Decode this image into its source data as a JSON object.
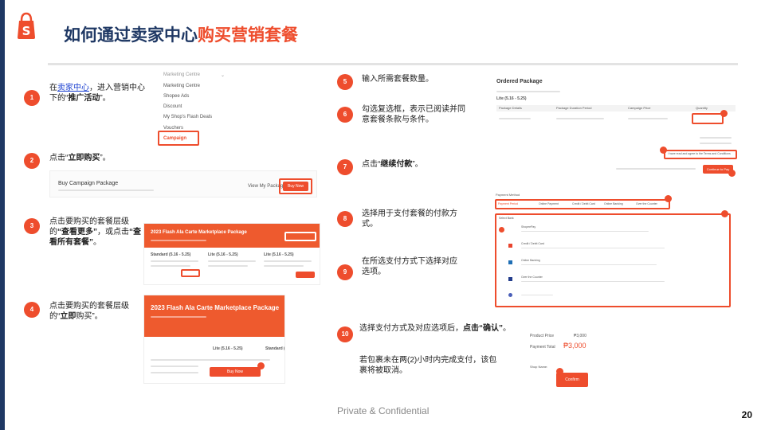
{
  "header": {
    "title_main": "如何通过卖家中心",
    "title_accent": "购买营销套餐"
  },
  "steps": [
    {
      "num": "1",
      "pre": "在",
      "link": "卖家中心",
      "mid": "，进入营销中心下的“",
      "bold": "推广活动",
      "post": "”。"
    },
    {
      "num": "2",
      "pre": "点击“",
      "bold": "立即购买",
      "post": "”。"
    },
    {
      "num": "3",
      "pre": "点击要购买的套餐层级的",
      "bold": "“查看更多”",
      "mid": "，或点击",
      "bold2": "“查看所有套餐”",
      "post": "。"
    },
    {
      "num": "4",
      "pre": "点击要购买的套餐层级的“",
      "bold": "立即",
      "post": "购买”。"
    },
    {
      "num": "5",
      "text": "输入所需套餐数量。"
    },
    {
      "num": "6",
      "text": "勾选复选框，表示已阅读并同意套餐条款与条件。"
    },
    {
      "num": "7",
      "pre": "点击“",
      "bold": "继续付款",
      "post": "”。"
    },
    {
      "num": "8",
      "text": "选择用于支付套餐的付款方式。"
    },
    {
      "num": "9",
      "text": "在所选支付方式下选择对应选项。"
    },
    {
      "num": "10",
      "pre": "选择支付方式及对应选项后，",
      "bold": "点击“确认”",
      "post": "。",
      "note": "若包裹未在两(2)小时内完成支付，该包裹将被取消。"
    }
  ],
  "menu_shot": {
    "header": "Marketing Centre",
    "items": [
      "Marketing Centre",
      "Shopee Ads",
      "Discount",
      "My Shop's Flash Deals",
      "Vouchers",
      "Campaign"
    ]
  },
  "buy_shot": {
    "title": "Buy Campaign Package",
    "view_label": "View My Package",
    "buy_label": "Buy Now"
  },
  "package_shot": {
    "title": "2023 Flash Ala Carte Marketplace Package",
    "tiers": [
      "Standard (5.16 - 5.25)",
      "Lite (5.16 - 5.25)",
      "Lite (5.16 - 5.25)"
    ]
  },
  "package_shot2": {
    "title": "2023 Flash Ala Carte Marketplace Package",
    "tier_left": "Lite (5.16 - 5.25)",
    "tier_right": "Standard (",
    "buy_label": "Buy Now"
  },
  "order_shot": {
    "title": "Ordered Package",
    "tier": "Lite (5.16 - 5.25)",
    "cols": [
      "Package Details",
      "Package Duration Period",
      "Campaign Price",
      "Quantity"
    ],
    "checkbox_label": "I have read and agree to the Terms and Conditions",
    "continue_label": "Continue to Pay"
  },
  "payment_shot": {
    "title": "Payment Method",
    "tabs": [
      "Payment Period",
      "Online Payment",
      "Credit / Debit Card",
      "Online Banking",
      "Over the Counter"
    ],
    "options": [
      "ShopeePay",
      "Credit / Debit Card",
      "Online Banking",
      "Over the Counter"
    ],
    "label": "Select Bank"
  },
  "confirm_shot": {
    "product_label": "Product Price",
    "product_value": "₱3,000",
    "total_label": "Payment Total",
    "total_value": "₱3,000",
    "shop_label": "Shop Name:",
    "confirm_label": "Confirm"
  },
  "footer": {
    "confidential": "Private & Confidential",
    "page": "20"
  },
  "colors": {
    "brand": "#ee4d2d",
    "navy": "#1f3864"
  },
  "icons": {
    "logo": "shopee-bag-icon"
  }
}
